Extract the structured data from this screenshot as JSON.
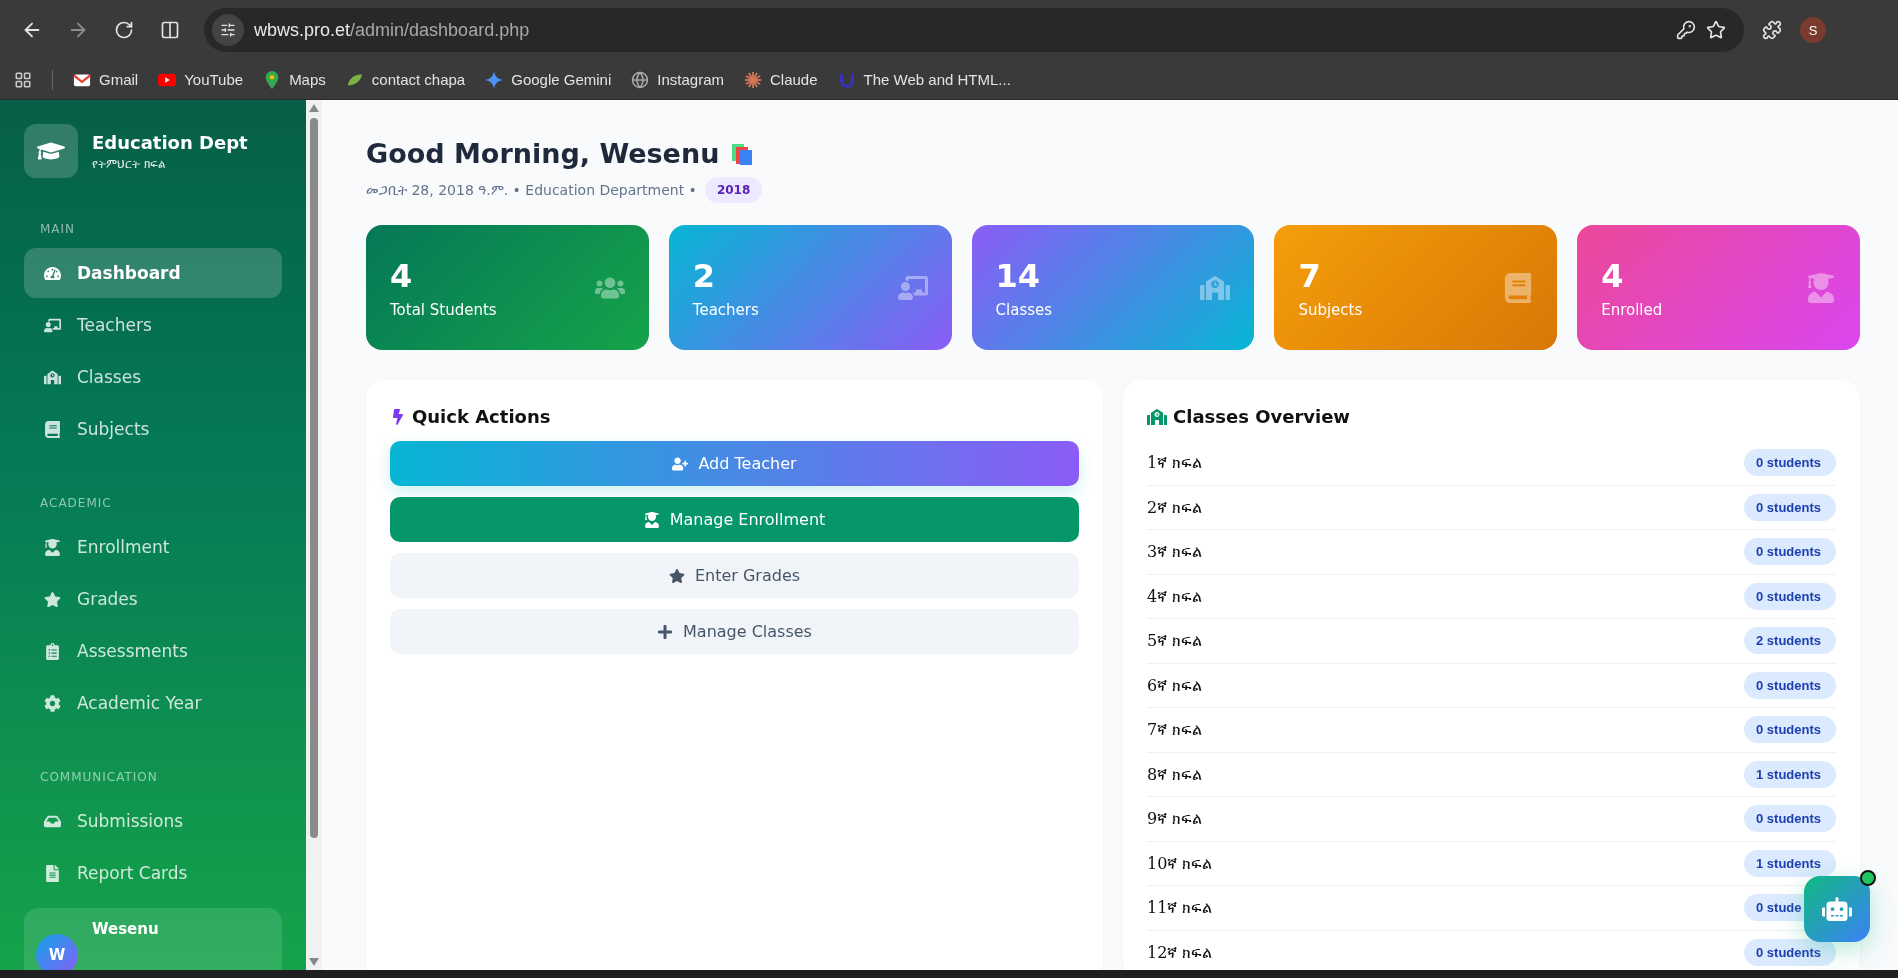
{
  "browser": {
    "url_host": "wbws.pro.et",
    "url_path": "/admin/dashboard.php",
    "profile": "S",
    "bookmarks": [
      {
        "label": "Gmail",
        "kind": "gmail"
      },
      {
        "label": "YouTube",
        "kind": "youtube"
      },
      {
        "label": "Maps",
        "kind": "maps"
      },
      {
        "label": "contact chapa",
        "kind": "chapa"
      },
      {
        "label": "Google Gemini",
        "kind": "gemini"
      },
      {
        "label": "Instagram",
        "kind": "globe"
      },
      {
        "label": "Claude",
        "kind": "claude"
      },
      {
        "label": "The Web and HTML...",
        "kind": "udemy"
      }
    ]
  },
  "sidebar": {
    "brand": {
      "title": "Education Dept",
      "subtitle": "የትምህርት ክፍል"
    },
    "sections": [
      {
        "title": "MAIN",
        "items": [
          {
            "label": "Dashboard",
            "selected": true
          },
          {
            "label": "Teachers",
            "selected": false
          },
          {
            "label": "Classes",
            "selected": false
          },
          {
            "label": "Subjects",
            "selected": false
          }
        ]
      },
      {
        "title": "ACADEMIC",
        "items": [
          {
            "label": "Enrollment",
            "selected": false
          },
          {
            "label": "Grades",
            "selected": false
          },
          {
            "label": "Assessments",
            "selected": false
          },
          {
            "label": "Academic Year",
            "selected": false
          }
        ]
      },
      {
        "title": "COMMUNICATION",
        "items": [
          {
            "label": "Submissions",
            "selected": false
          },
          {
            "label": "Report Cards",
            "selected": false
          }
        ]
      }
    ],
    "user": {
      "name": "Wesenu",
      "initial": "W"
    }
  },
  "greeting": {
    "title": "Good Morning, Wesenu",
    "date": "መጋቢት 28, 2018 ዓ.ም. • Education Department •",
    "year": "2018"
  },
  "stats": [
    {
      "value": "4",
      "label": "Total Students",
      "kind": "students"
    },
    {
      "value": "2",
      "label": "Teachers",
      "kind": "teachers"
    },
    {
      "value": "14",
      "label": "Classes",
      "kind": "classes"
    },
    {
      "value": "7",
      "label": "Subjects",
      "kind": "subjects"
    },
    {
      "value": "4",
      "label": "Enrolled",
      "kind": "enrolled"
    }
  ],
  "quick_actions": {
    "title": "Quick Actions",
    "buttons": [
      {
        "label": "Add Teacher",
        "kind": "gradient"
      },
      {
        "label": "Manage Enrollment",
        "kind": "green"
      },
      {
        "label": "Enter Grades",
        "kind": "plain"
      },
      {
        "label": "Manage Classes",
        "kind": "plain"
      }
    ]
  },
  "classes_overview": {
    "title": "Classes Overview",
    "rows": [
      {
        "name": "1ኛ ክፍል",
        "count": "0 students"
      },
      {
        "name": "2ኛ ክፍል",
        "count": "0 students"
      },
      {
        "name": "3ኛ ክፍል",
        "count": "0 students"
      },
      {
        "name": "4ኛ ክፍል",
        "count": "0 students"
      },
      {
        "name": "5ኛ ክፍል",
        "count": "2 students"
      },
      {
        "name": "6ኛ ክፍል",
        "count": "0 students"
      },
      {
        "name": "7ኛ ክፍል",
        "count": "0 students"
      },
      {
        "name": "8ኛ ክፍል",
        "count": "1 students"
      },
      {
        "name": "9ኛ ክፍል",
        "count": "0 students"
      },
      {
        "name": "10ኛ ክፍል",
        "count": "1 students"
      },
      {
        "name": "11ኛ ክፍል",
        "count": "0 stude"
      },
      {
        "name": "12ኛ ክፍል",
        "count": "0 students"
      }
    ]
  },
  "assistant": {
    "online": true
  }
}
